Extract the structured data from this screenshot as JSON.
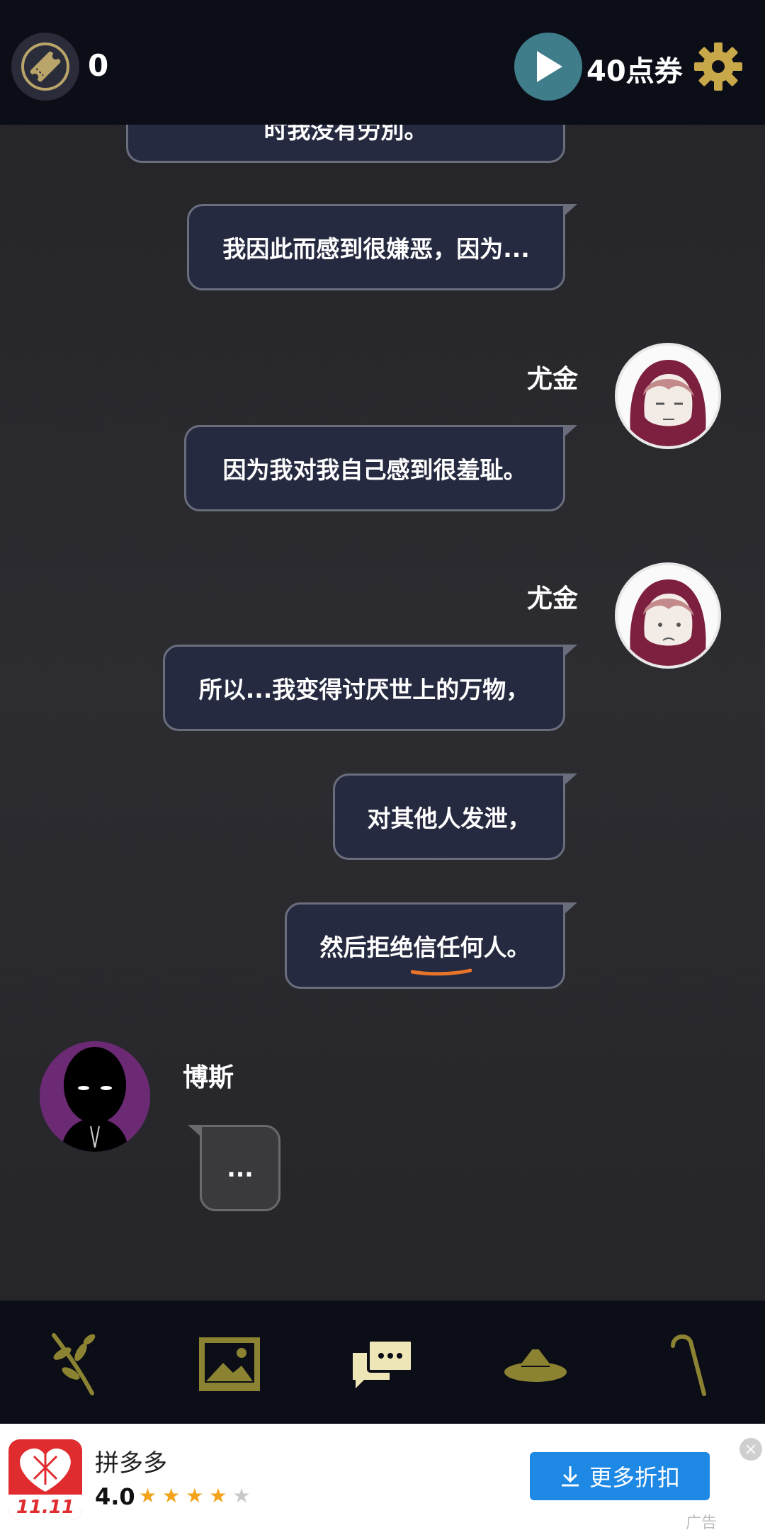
{
  "topbar": {
    "ticket_count": "0",
    "points_label": "40点券",
    "icons": [
      "ticket-icon",
      "play-icon",
      "gear-icon"
    ]
  },
  "chat": {
    "messages": [
      {
        "side": "right",
        "text": "时我没有労別。"
      },
      {
        "side": "right",
        "text": "我因此而感到很嫌恶，因为..."
      },
      {
        "side": "right",
        "speaker": "尤金",
        "text": "因为我对我自己感到很羞耻。"
      },
      {
        "side": "right",
        "speaker": "尤金",
        "text": "所以...我变得讨厌世上的万物，"
      },
      {
        "side": "right",
        "text": "对其他人发泄，"
      },
      {
        "side": "right",
        "text": "然后拒绝信任何人。"
      },
      {
        "side": "left",
        "speaker": "博斯",
        "text": "..."
      }
    ]
  },
  "navbar": {
    "items": [
      "branch-icon",
      "gallery-icon",
      "chat-icon",
      "hat-icon",
      "cane-icon"
    ],
    "active": "chat-icon",
    "accent": "#8c8332",
    "active_color": "#efe6b8"
  },
  "ad": {
    "app_name": "拼多多",
    "logo_text": "11.11",
    "rating": "4.0",
    "stars_filled": 4,
    "stars_total": 5,
    "button_label": "更多折扣",
    "tag": "广告",
    "close": "×"
  }
}
